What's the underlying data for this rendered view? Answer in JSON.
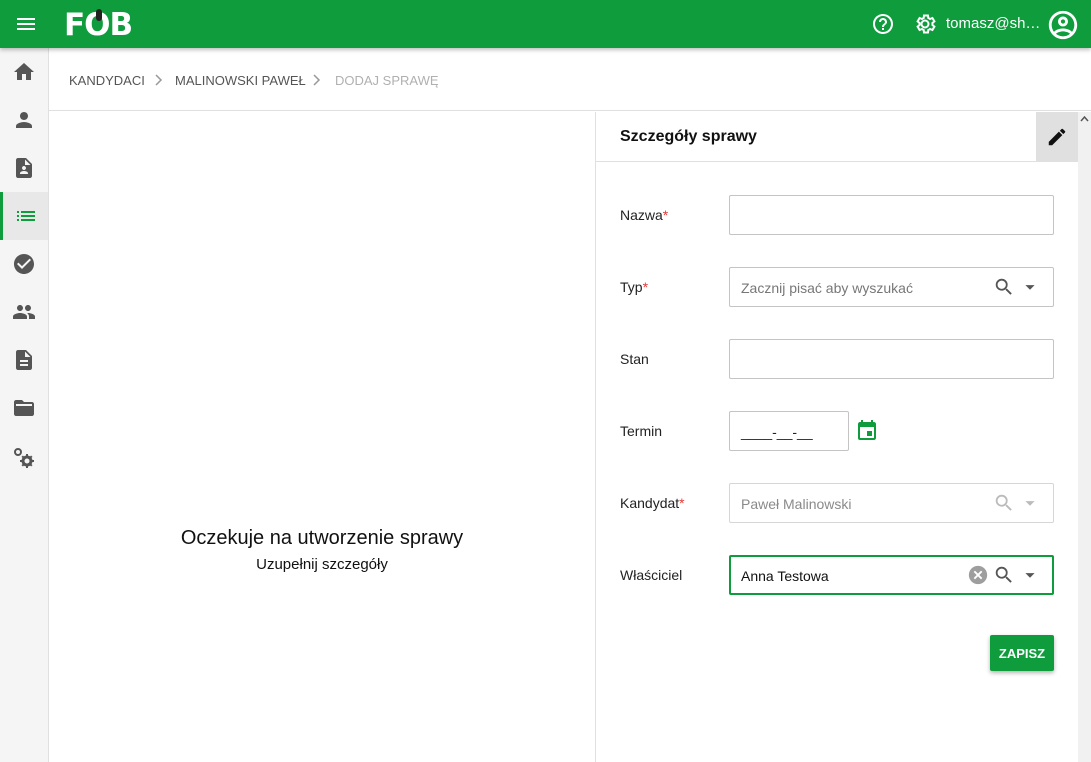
{
  "header": {
    "logo_text": "FOB",
    "user": "tomasz@sharpcode.pl",
    "brand_color": "#0e9c3d"
  },
  "sidebar": {
    "items": [
      {
        "icon": "home-icon"
      },
      {
        "icon": "person-icon"
      },
      {
        "icon": "contact-document-icon"
      },
      {
        "icon": "list-icon",
        "active": true
      },
      {
        "icon": "check-circle-icon"
      },
      {
        "icon": "people-icon"
      },
      {
        "icon": "description-icon"
      },
      {
        "icon": "folder-open-icon"
      },
      {
        "icon": "settings-applications-icon"
      }
    ]
  },
  "breadcrumb": {
    "items": [
      "KANDYDACI",
      "MALINOWSKI PAWEŁ",
      "DODAJ SPRAWĘ"
    ]
  },
  "left_pane": {
    "title": "Oczekuje na utworzenie sprawy",
    "subtitle": "Uzupełnij szczegóły"
  },
  "panel": {
    "title": "Szczegóły sprawy",
    "fields": {
      "nazwa": {
        "label": "Nazwa",
        "required": "*",
        "value": ""
      },
      "typ": {
        "label": "Typ",
        "required": "*",
        "placeholder": "Zacznij pisać aby wyszukać"
      },
      "stan": {
        "label": "Stan",
        "value": ""
      },
      "termin": {
        "label": "Termin",
        "mask": "____-__-__"
      },
      "kandydat": {
        "label": "Kandydat",
        "required": "*",
        "value": "Paweł Malinowski"
      },
      "wlasciciel": {
        "label": "Właściciel",
        "value": "Anna Testowa"
      }
    },
    "save_label": "ZAPISZ"
  }
}
